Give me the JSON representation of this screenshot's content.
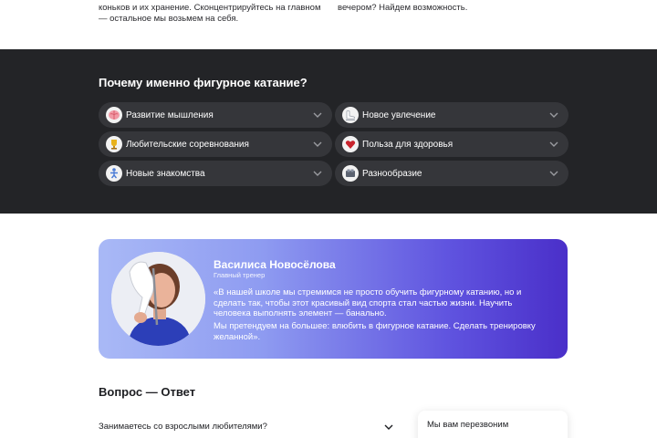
{
  "intro": {
    "left_lines": [
      "",
      "коньков и их хранение. Сконцентрируйтесь на главном",
      "— остальное мы возьмем на себя."
    ],
    "right_lines": [
      "",
      "вечером? Найдем возможность."
    ]
  },
  "why": {
    "title": "Почему именно фигурное катание?",
    "items": [
      {
        "label": "Развитие мышления",
        "icon": "brain-icon"
      },
      {
        "label": "Новое увлечение",
        "icon": "skate-icon"
      },
      {
        "label": "Любительские соревнования",
        "icon": "trophy-icon"
      },
      {
        "label": "Польза для здоровья",
        "icon": "heart-icon"
      },
      {
        "label": "Новые знакомства",
        "icon": "skater-icon"
      },
      {
        "label": "Разнообразие",
        "icon": "spa-icon"
      }
    ]
  },
  "coach": {
    "name": "Василиса Новосёлова",
    "role": "Главный тренер",
    "quote": "«В нашей школе мы стремимся не просто обучить фигурному катанию, но и сделать так, чтобы этот красивый вид спорта стал частью жизни. Научить человека выполнять элемент — банально.",
    "quote2": "Мы претендуем на большее: влюбить в фигурное катание. Сделать тренировку желанной»."
  },
  "faq": {
    "title": "Вопрос — Ответ",
    "items": [
      {
        "question": "Занимаетесь со взрослыми любителями?"
      }
    ]
  },
  "callback": {
    "label": "Мы вам перезвоним"
  }
}
